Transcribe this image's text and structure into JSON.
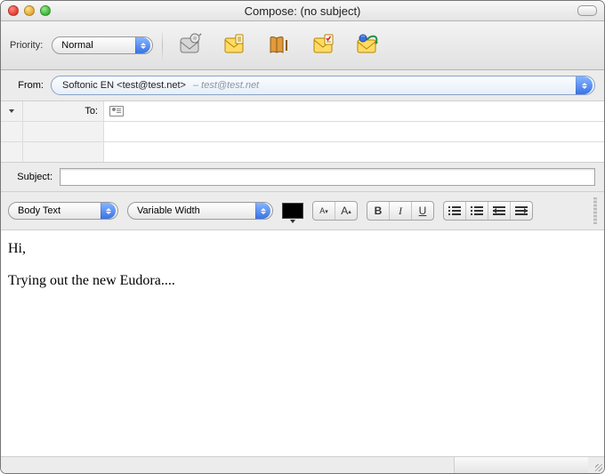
{
  "window": {
    "title": "Compose: (no subject)"
  },
  "toolbar": {
    "priority_label": "Priority:",
    "priority_value": "Normal"
  },
  "from": {
    "label": "From:",
    "account": "Softonic EN <test@test.net>",
    "dim": "– test@test.net"
  },
  "recipients": {
    "rows": [
      {
        "label": "To:"
      },
      {
        "label": ""
      },
      {
        "label": ""
      }
    ]
  },
  "subject": {
    "label": "Subject:",
    "value": ""
  },
  "format": {
    "para_style": "Body Text",
    "font_family": "Variable Width",
    "color": "#000000",
    "smaller": "A",
    "larger": "A",
    "bold": "B",
    "italic": "I",
    "underline": "U"
  },
  "body": {
    "line1": "Hi,",
    "line2": "Trying out the new Eudora...."
  }
}
